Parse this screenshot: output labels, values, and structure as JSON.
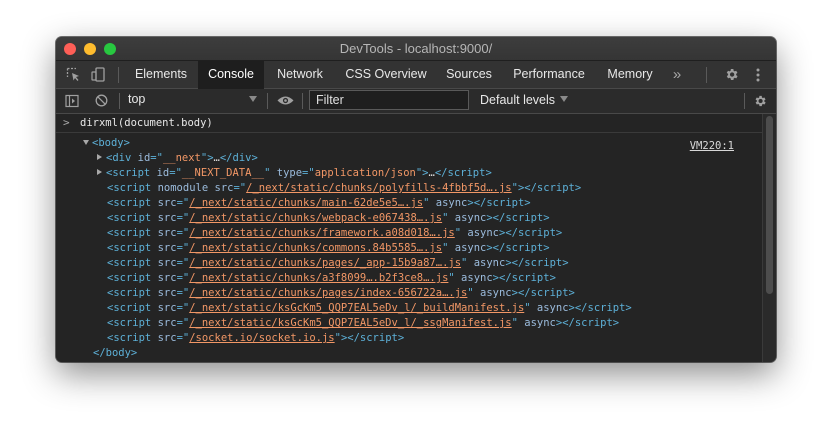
{
  "window": {
    "title": "DevTools - localhost:9000/"
  },
  "tabs": [
    {
      "label": "Elements"
    },
    {
      "label": "Console"
    },
    {
      "label": "Network"
    },
    {
      "label": "CSS Overview"
    },
    {
      "label": "Sources"
    },
    {
      "label": "Performance"
    },
    {
      "label": "Memory"
    }
  ],
  "tabbar": {
    "overflow": "»"
  },
  "toolbar": {
    "context": "top",
    "filter_placeholder": "Filter",
    "levels": "Default levels"
  },
  "console": {
    "prompt": ">",
    "command": "dirxml(document.body)",
    "source_link": "VM220:1"
  },
  "dom": {
    "body_open": "<body>",
    "body_close": "</body>",
    "div_next": {
      "tag": "div",
      "id": "__next"
    },
    "next_data": {
      "tag": "script",
      "id": "__NEXT_DATA__",
      "type": "application/json"
    },
    "ellipsis": "…",
    "scripts": [
      {
        "prefix": "nomodule ",
        "src": "/_next/static/chunks/polyfills-4fbbf5d….js",
        "suffix": ""
      },
      {
        "prefix": "",
        "src": "/_next/static/chunks/main-62de5e5….js",
        "suffix": " async"
      },
      {
        "prefix": "",
        "src": "/_next/static/chunks/webpack-e067438….js",
        "suffix": " async"
      },
      {
        "prefix": "",
        "src": "/_next/static/chunks/framework.a08d018….js",
        "suffix": " async"
      },
      {
        "prefix": "",
        "src": "/_next/static/chunks/commons.84b5585….js",
        "suffix": " async"
      },
      {
        "prefix": "",
        "src": "/_next/static/chunks/pages/_app-15b9a87….js",
        "suffix": " async"
      },
      {
        "prefix": "",
        "src": "/_next/static/chunks/a3f8099….b2f3ce8….js",
        "suffix": " async"
      },
      {
        "prefix": "",
        "src": "/_next/static/chunks/pages/index-656722a….js",
        "suffix": " async"
      },
      {
        "prefix": "",
        "src": "/_next/static/ksGcKm5_QQP7EAL5eDv_l/_buildManifest.js",
        "suffix": " async"
      },
      {
        "prefix": "",
        "src": "/_next/static/ksGcKm5_QQP7EAL5eDv_l/_ssgManifest.js",
        "suffix": " async"
      },
      {
        "prefix": "",
        "src": "/socket.io/socket.io.js",
        "suffix": ""
      }
    ]
  },
  "colors": {
    "tag": "#5db0d7",
    "attr_name": "#9bbbdc",
    "attr_value": "#f29766",
    "background": "#242424"
  }
}
